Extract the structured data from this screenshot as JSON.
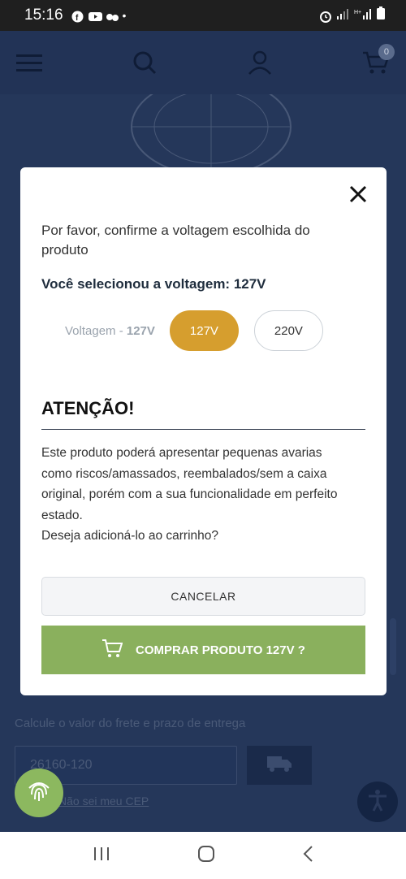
{
  "status_bar": {
    "time": "15:16"
  },
  "header": {
    "cart_count": "0"
  },
  "background": {
    "freight_label": "Calcule o valor do frete e prazo de entrega",
    "cep_value": "26160-120",
    "cep_link": "Não sei meu CEP"
  },
  "modal": {
    "confirm_text": "Por favor, confirme a voltagem escolhida do produto",
    "selected_text": "Você selecionou a voltagem: 127V",
    "voltage_label_prefix": "Voltagem - ",
    "voltage_label_value": "127V",
    "options": [
      "127V",
      "220V"
    ],
    "attention_title": "ATENÇÃO!",
    "warning_lines": [
      "Este produto poderá apresentar pequenas avarias",
      "como riscos/amassados, reembalados/sem a caixa",
      "original, porém com a sua funcionalidade em perfeito",
      "estado.",
      "Deseja adicioná-lo ao carrinho?"
    ],
    "cancel_label": "CANCELAR",
    "buy_label": "COMPRAR PRODUTO 127V ?"
  },
  "colors": {
    "accent_gold": "#d69e2e",
    "buy_green": "#8ab05d",
    "overlay_navy": "#25375a"
  },
  "icons": {
    "menu": "menu-icon",
    "search": "search-icon",
    "user": "user-icon",
    "cart": "cart-icon",
    "close": "close-icon",
    "truck": "truck-icon",
    "fingerprint": "fingerprint-icon",
    "accessibility": "accessibility-icon"
  }
}
